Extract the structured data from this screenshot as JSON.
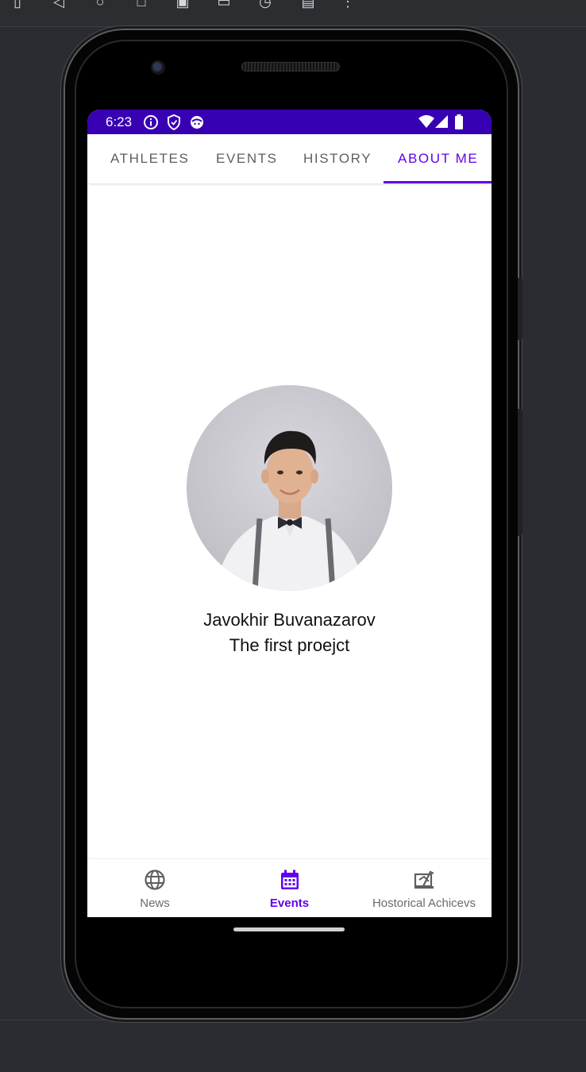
{
  "emulator": {
    "toolbar_icons": [
      "rotate-icon",
      "back-icon",
      "home-icon",
      "overview-icon",
      "screenshot-icon",
      "camera-icon",
      "snapshot-icon",
      "touch-icon",
      "more-icon"
    ]
  },
  "statusbar": {
    "time": "6:23",
    "icons": [
      "info-icon",
      "shield-icon",
      "face-icon",
      "wifi-icon",
      "signal-icon",
      "battery-icon"
    ],
    "color": "#3700b3"
  },
  "tabs": [
    {
      "label": "ATHLETES",
      "active": false
    },
    {
      "label": "EVENTS",
      "active": false
    },
    {
      "label": "HISTORY",
      "active": false
    },
    {
      "label": "ABOUT ME",
      "active": true
    }
  ],
  "profile": {
    "name": "Javokhir Buvanazarov",
    "subtitle": "The first proejct"
  },
  "bottom_nav": [
    {
      "label": "News",
      "icon": "globe-icon",
      "active": false
    },
    {
      "label": "Events",
      "icon": "calendar-icon",
      "active": true
    },
    {
      "label": "Hostorical Achicevs",
      "icon": "history-board-icon",
      "active": false
    }
  ],
  "accent": "#6200ee"
}
